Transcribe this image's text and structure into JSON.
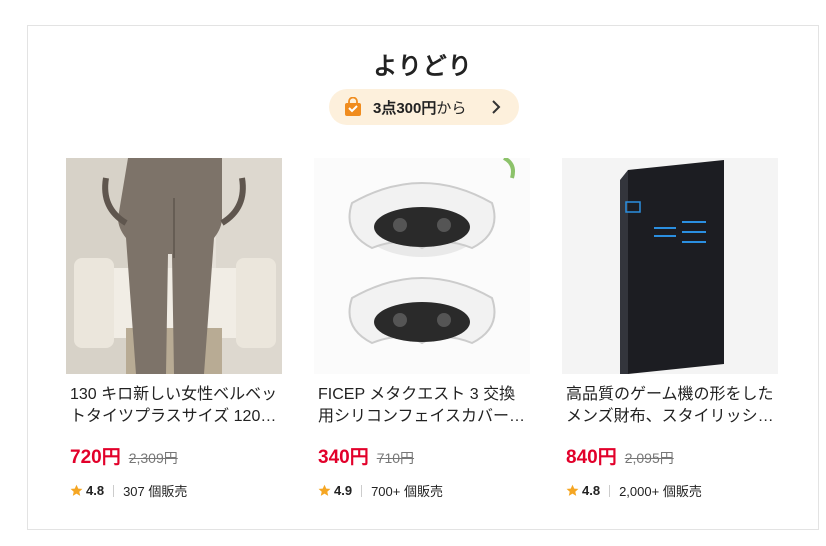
{
  "section": {
    "title": "よりどり",
    "promo": {
      "text_bold": "3点300円",
      "text_light": "から",
      "icon": "shopping-bag-icon",
      "chevron": "chevron-right-icon"
    }
  },
  "colors": {
    "price": "#e2002a",
    "promo_bg": "#fdf0dc",
    "star": "#f5a623",
    "bag": "#f08c1e"
  },
  "products": [
    {
      "name": "130 キロ新しい女性ベルベットタイツプラスサイズ 120…",
      "price": "720円",
      "original_price": "2,309円",
      "rating": "4.8",
      "sold": "307 個販売"
    },
    {
      "name": "FICEP メタクエスト 3 交換用シリコンフェイスカバー…",
      "price": "340円",
      "original_price": "710円",
      "rating": "4.9",
      "sold": "700+ 個販売"
    },
    {
      "name": "高品質のゲーム機の形をしたメンズ財布、スタイリッシ…",
      "price": "840円",
      "original_price": "2,095円",
      "rating": "4.8",
      "sold": "2,000+ 個販売"
    }
  ]
}
